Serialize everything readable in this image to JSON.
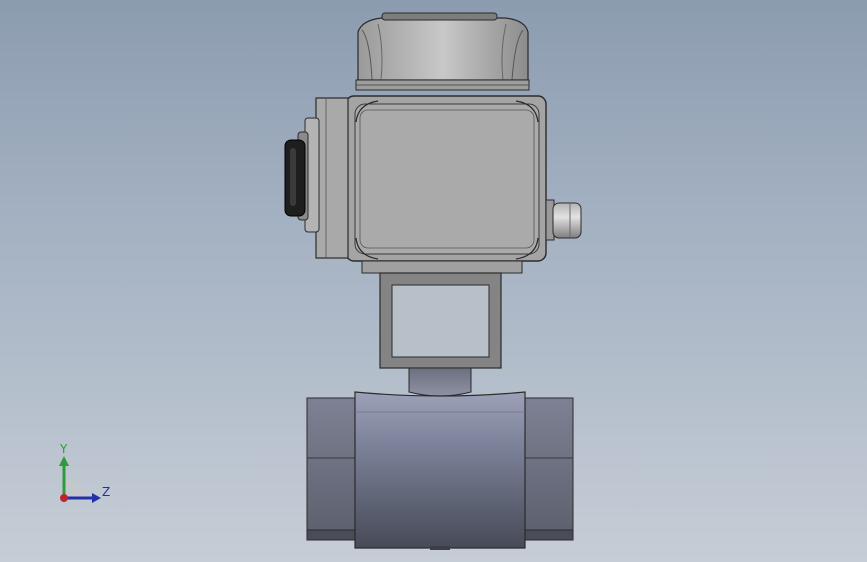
{
  "viewport": {
    "background_top": "#8c9cb0",
    "background_bottom": "#c6cdd6"
  },
  "model": {
    "parts": [
      "electric-actuator",
      "mounting-bracket",
      "valve-stem",
      "ball-valve-body"
    ]
  },
  "triad": {
    "y_label": "Y",
    "z_label": "Z",
    "y_color": "#2e9b3a",
    "z_color": "#2430a8",
    "x_color": "#c0242a"
  }
}
